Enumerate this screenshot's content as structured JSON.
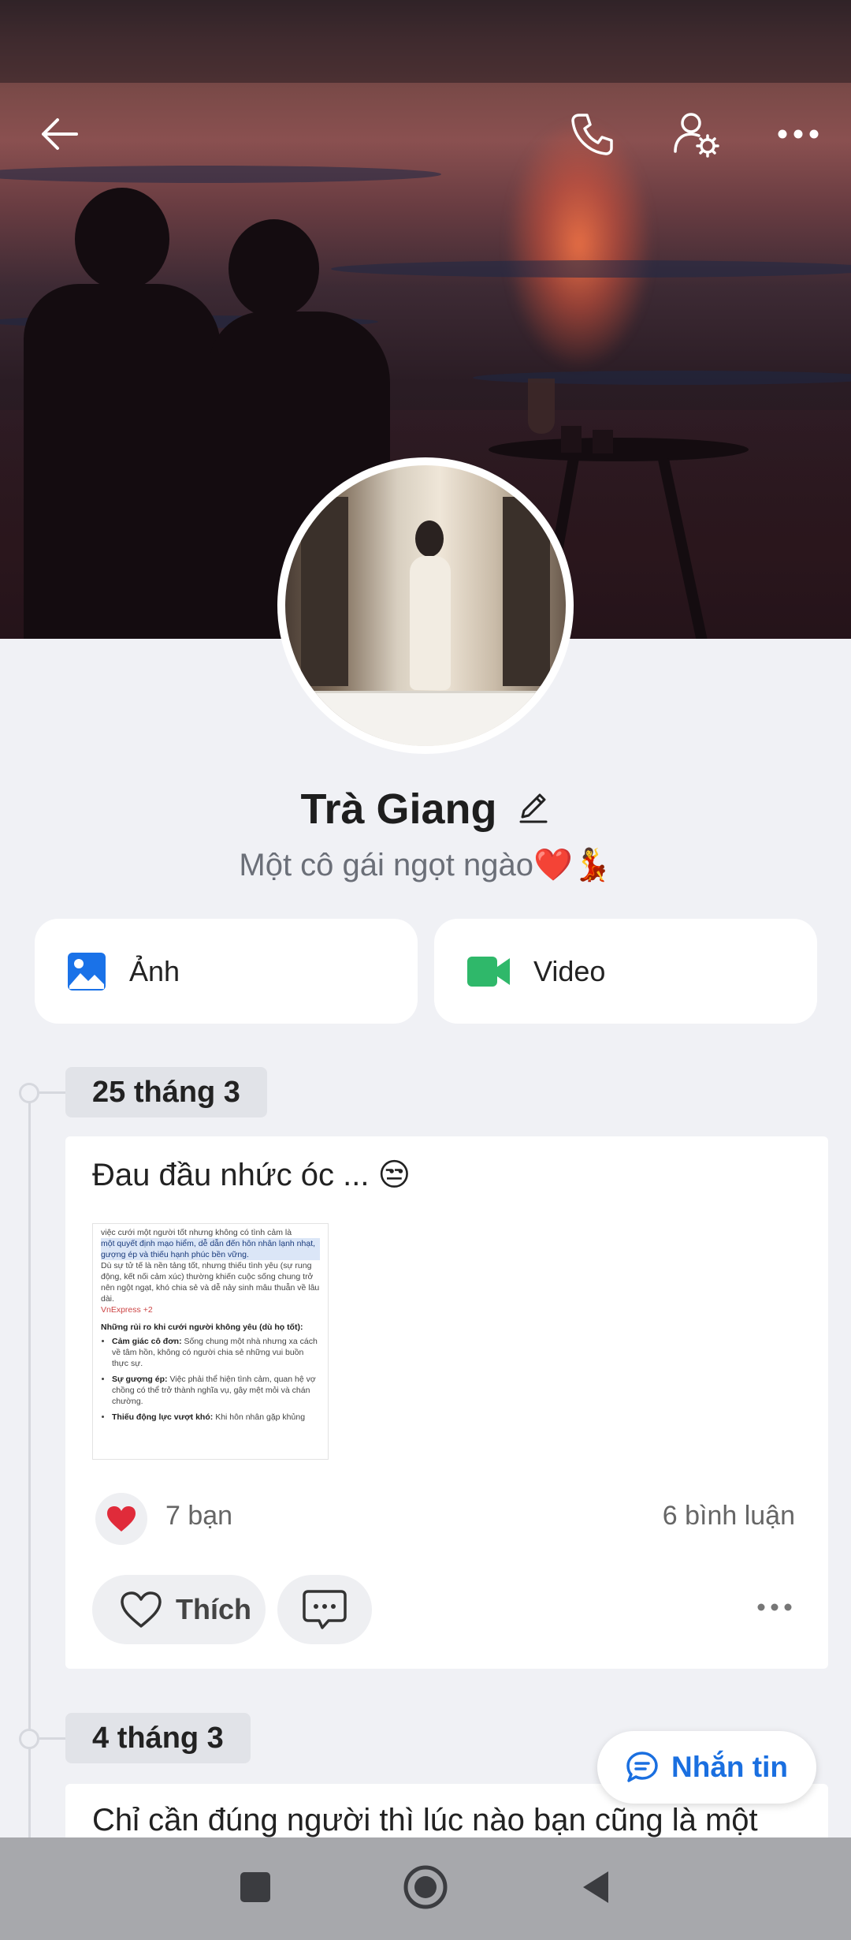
{
  "profile": {
    "name": "Trà Giang",
    "bio": "Một cô gái ngọt ngào❤️💃"
  },
  "media": {
    "photos_label": "Ảnh",
    "video_label": "Video"
  },
  "posts": [
    {
      "date": "25 tháng 3",
      "text": "Đau đầu nhức óc ... 😒",
      "thumbnail": {
        "line1": "việc cưới một người tốt nhưng không có tình cảm là",
        "highlight": "một quyết định mạo hiểm, dễ dẫn đến hôn nhân lạnh nhạt, gượng ép và thiếu hạnh phúc bền vững.",
        "para": "Dù sự tử tế là nền tảng tốt, nhưng thiếu tình yêu (sự rung động, kết nối cảm xúc) thường khiến cuộc sống chung trở nên ngột ngạt, khó chia sẻ và dễ nảy sinh mâu thuẫn về lâu dài.",
        "source": "VnExpress +2",
        "heading": "Những rủi ro khi cưới người không yêu (dù họ tốt):",
        "bullets": [
          {
            "title": "Cảm giác cô đơn:",
            "text": "Sống chung một nhà nhưng xa cách về tâm hồn, không có người chia sẻ những vui buồn thực sự."
          },
          {
            "title": "Sự gượng ép:",
            "text": "Việc phải thể hiện tình cảm, quan hệ vợ chồng có thể trở thành nghĩa vụ, gây mệt mỏi và chán chường."
          },
          {
            "title": "Thiếu động lực vượt khó:",
            "text": "Khi hôn nhân gặp khủng"
          }
        ]
      },
      "reactions": "7 bạn",
      "comments": "6 bình luận",
      "like_label": "Thích"
    },
    {
      "date": "4 tháng 3",
      "text": "Chỉ cần đúng người thì lúc nào bạn cũng là một"
    }
  ],
  "message_button": "Nhắn tin",
  "icons": {
    "back": "arrow-left-icon",
    "call": "phone-icon",
    "settings": "user-settings-icon",
    "more": "more-horizontal-icon",
    "photos": "image-icon",
    "video": "video-camera-icon",
    "heart": "heart-icon",
    "comment": "comment-icon",
    "chat": "chat-bubble-icon"
  },
  "colors": {
    "accent": "#1a6fe0",
    "photo_icon": "#1a72e8",
    "video_icon": "#2fb86a",
    "heart": "#e02b3a",
    "background": "#f0f1f5"
  }
}
